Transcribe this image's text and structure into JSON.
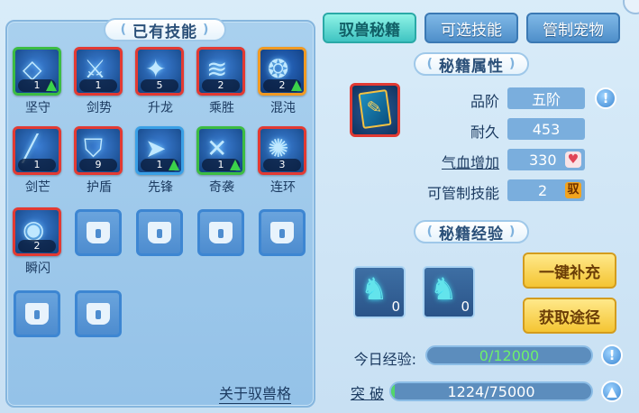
{
  "left": {
    "title": "已有技能",
    "skills": [
      {
        "name": "坚守",
        "level": "1",
        "upgrade": true
      },
      {
        "name": "剑势",
        "level": "1",
        "upgrade": false
      },
      {
        "name": "升龙",
        "level": "5",
        "upgrade": false
      },
      {
        "name": "乘胜",
        "level": "2",
        "upgrade": false
      },
      {
        "name": "混沌",
        "level": "2",
        "upgrade": true
      },
      {
        "name": "剑芒",
        "level": "1",
        "upgrade": false
      },
      {
        "name": "护盾",
        "level": "9",
        "upgrade": false
      },
      {
        "name": "先锋",
        "level": "1",
        "upgrade": true
      },
      {
        "name": "奇袭",
        "level": "1",
        "upgrade": true
      },
      {
        "name": "连环",
        "level": "3",
        "upgrade": false
      },
      {
        "name": "瞬闪",
        "level": "2",
        "upgrade": false
      }
    ],
    "about_link": "关于驭兽格"
  },
  "tabs": [
    "驭兽秘籍",
    "可选技能",
    "管制宠物"
  ],
  "attributes": {
    "title": "秘籍属性",
    "rows": [
      {
        "label": "品阶",
        "value": "五阶"
      },
      {
        "label": "耐久",
        "value": "453"
      },
      {
        "label": "气血增加",
        "value": "330"
      },
      {
        "label": "可管制技能",
        "value": "2"
      }
    ],
    "control_badge": "驭"
  },
  "experience": {
    "title": "秘籍经验",
    "items": [
      {
        "count": "0"
      },
      {
        "count": "0"
      }
    ],
    "buttons": {
      "refill": "一键补充",
      "obtain": "获取途径"
    },
    "today_label": "今日经验:",
    "today_value": "0/12000",
    "break_label": "突 破",
    "break_value": "1224/75000",
    "break_progress": 0.0163
  },
  "icons": {
    "info": "exclamation-icon",
    "heart": "heart-icon",
    "up": "up-arrow-icon"
  }
}
